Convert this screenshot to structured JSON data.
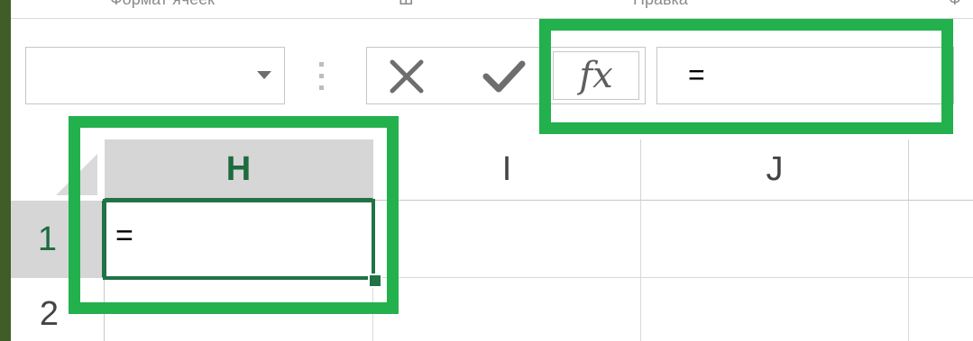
{
  "ribbon": {
    "group_labels": [
      "Формат ячеек",
      "Ш",
      "Правка",
      "Ф"
    ]
  },
  "formula_bar": {
    "name_box_value": "",
    "cancel_icon": "x-icon",
    "enter_icon": "checkmark-icon",
    "function_label": "fx",
    "formula_value": "="
  },
  "sheet": {
    "columns": [
      "H",
      "I",
      "J",
      ""
    ],
    "rows": [
      "1",
      "2"
    ],
    "active_cell_value": "=",
    "active_column": "H",
    "active_row": "1"
  },
  "colors": {
    "excel_green": "#217346",
    "highlight_green": "#22b14c",
    "header_active_bg": "#d6d6d6"
  }
}
